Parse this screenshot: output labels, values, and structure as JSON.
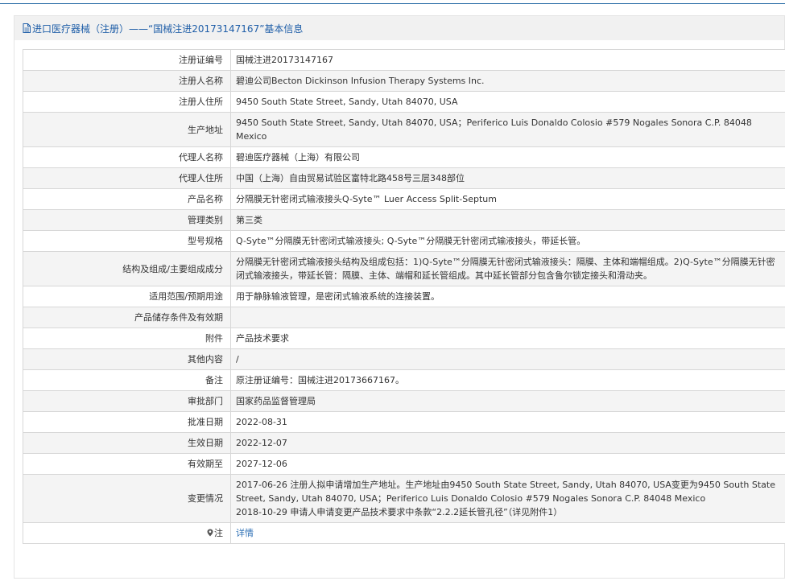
{
  "header": {
    "title": "进口医疗器械（注册）——“国械注进20173147167”基本信息"
  },
  "rows": [
    {
      "label": "注册证编号",
      "value": "国械注进20173147167"
    },
    {
      "label": "注册人名称",
      "value": "碧迪公司Becton Dickinson Infusion Therapy Systems Inc."
    },
    {
      "label": "注册人住所",
      "value": "9450 South State Street, Sandy, Utah 84070, USA"
    },
    {
      "label": "生产地址",
      "value": "9450 South State Street, Sandy, Utah 84070, USA；Periferico Luis Donaldo Colosio #579 Nogales Sonora C.P. 84048 Mexico"
    },
    {
      "label": "代理人名称",
      "value": "碧迪医疗器械（上海）有限公司"
    },
    {
      "label": "代理人住所",
      "value": "中国（上海）自由贸易试验区富特北路458号三层348部位"
    },
    {
      "label": "产品名称",
      "value": "分隔膜无针密闭式输液接头Q-Syte™ Luer Access Split-Septum"
    },
    {
      "label": "管理类别",
      "value": "第三类"
    },
    {
      "label": "型号规格",
      "value": "Q-Syte™分隔膜无针密闭式输液接头; Q-Syte™分隔膜无针密闭式输液接头，带延长管。"
    },
    {
      "label": "结构及组成/主要组成成分",
      "value": "分隔膜无针密闭式输液接头结构及组成包括：1)Q-Syte™分隔膜无针密闭式输液接头：隔膜、主体和端帽组成。2)Q-Syte™分隔膜无针密闭式输液接头，带延长管：隔膜、主体、端帽和延长管组成。其中延长管部分包含鲁尔锁定接头和滑动夹。"
    },
    {
      "label": "适用范围/预期用途",
      "value": "用于静脉输液管理，是密闭式输液系统的连接装置。"
    },
    {
      "label": "产品储存条件及有效期",
      "value": ""
    },
    {
      "label": "附件",
      "value": "产品技术要求"
    },
    {
      "label": "其他内容",
      "value": "/"
    },
    {
      "label": "备注",
      "value": "原注册证编号：国械注进20173667167。"
    },
    {
      "label": "审批部门",
      "value": "国家药品监督管理局"
    },
    {
      "label": "批准日期",
      "value": "2022-08-31"
    },
    {
      "label": "生效日期",
      "value": "2022-12-07"
    },
    {
      "label": "有效期至",
      "value": "2027-12-06"
    }
  ],
  "change": {
    "label": "变更情况",
    "lines": [
      "2017-06-26 注册人拟申请增加生产地址。生产地址由9450 South State Street, Sandy, Utah 84070, USA变更为9450 South State Street, Sandy, Utah 84070, USA；Periferico Luis Donaldo Colosio #579 Nogales Sonora C.P. 84048 Mexico",
      "2018-10-29 申请人申请变更产品技术要求中条款“2.2.2延长管孔径”（详见附件1）"
    ]
  },
  "note": {
    "label": "注",
    "icon": "map-pin-icon",
    "link_text": "详情"
  }
}
